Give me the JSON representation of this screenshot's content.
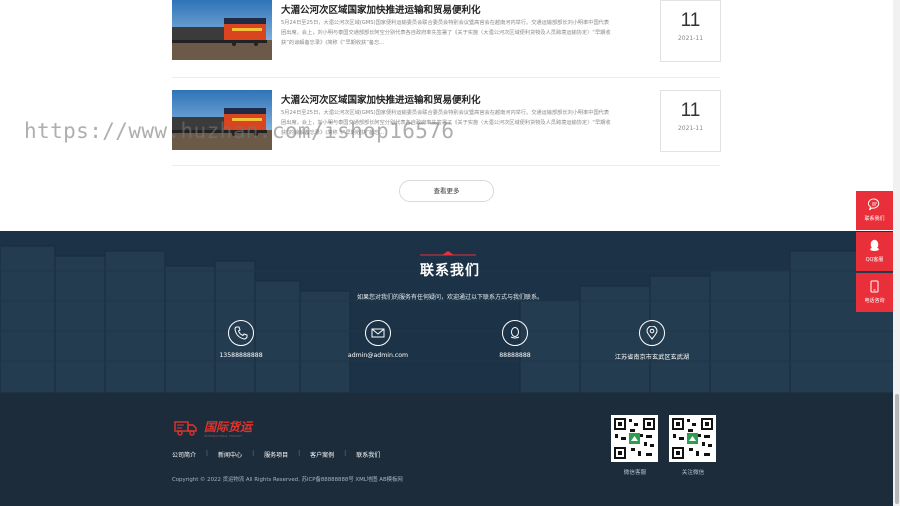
{
  "news": {
    "items": [
      {
        "title": "大湄公河次区域国家加快推进运输和贸易便利化",
        "desc": "5月24日至25日，大湄公河次区域(GMS)国家便利运输委员会联合委员会特别会议暨高官会在越南河内举行。交通运输部部长刘小明率中国代表团出席。会上，刘小明与泰国交通部部长阿空分别代表各自政府率先签署了《关于实施〈大湄公河次区域便利货物及人员跨境运输协定〉“早期收获”的谅解备忘录》(简称《“早期收获”备忘...",
        "day": "11",
        "ym": "2021-11"
      },
      {
        "title": "大湄公河次区域国家加快推进运输和贸易便利化",
        "desc": "5月24日至25日，大湄公河次区域(GMS)国家便利运输委员会联合委员会特别会议暨高官会在越南河内举行。交通运输部部长刘小明率中国代表团出席。会上，刘小明与泰国交通部部长阿空分别代表各自政府率先签署了《关于实施〈大湄公河次区域便利货物及人员跨境运输协定〉“早期收获”的谅解备忘录》(简称《“早期收获”备忘...",
        "day": "11",
        "ym": "2021-11"
      }
    ],
    "more_label": "查看更多"
  },
  "watermark": "https://www.huzhan.com/ishop16576",
  "contact": {
    "title": "联系我们",
    "subtitle": "如果您对我们的服务有任何疑问，欢迎通过以下联系方式与我们联系。",
    "phone": "13588888888",
    "email": "admin@admin.com",
    "qq": "88888888",
    "address": "江苏省南京市玄武区玄武湖"
  },
  "footer": {
    "logo_text": "国际货运",
    "logo_sub": "INTERNATIONAL FREIGHT",
    "nav": [
      "公司简介",
      "新闻中心",
      "服务项目",
      "客户案例",
      "联系我们"
    ],
    "copyright": "Copyright © 2022 货运物流 All Rights Reserved. 苏ICP备88888888号 XML地图 AB模板网",
    "qr": [
      "微信客服",
      "关注微信"
    ]
  },
  "side": {
    "contact": "联系我们",
    "qq": "QQ客服",
    "phone": "电话咨询"
  },
  "colors": {
    "accent": "#e9303a",
    "contact_bg": "#20374a",
    "footer_bg": "#1c2c3b",
    "logo": "#e0342d"
  }
}
